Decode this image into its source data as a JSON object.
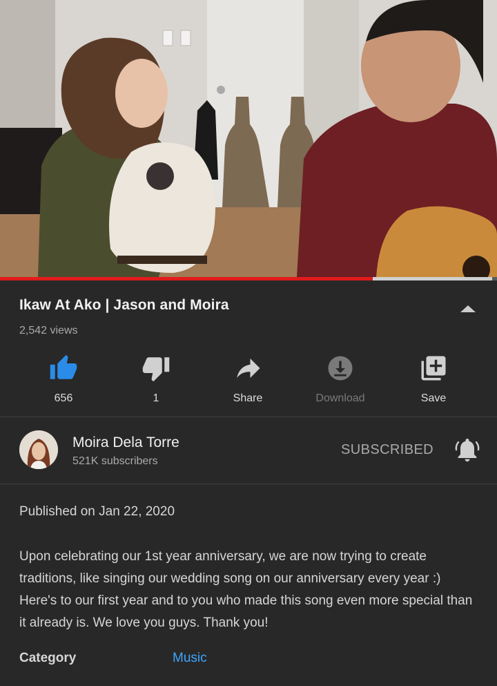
{
  "video": {
    "progress_fraction": 0.75,
    "buffer_fraction": 0.99
  },
  "title": "Ikaw At Ako | Jason and Moira",
  "views": "2,542 views",
  "actions": [
    {
      "icon": "thumbs-up-icon",
      "label": "656",
      "active": true
    },
    {
      "icon": "thumbs-down-icon",
      "label": "1",
      "active": false
    },
    {
      "icon": "share-icon",
      "label": "Share",
      "active": false
    },
    {
      "icon": "download-icon",
      "label": "Download",
      "active": false,
      "disabled": true
    },
    {
      "icon": "add-to-playlist-icon",
      "label": "Save",
      "active": false
    }
  ],
  "channel": {
    "name": "Moira Dela Torre",
    "subscribers": "521K subscribers",
    "subscribe_label": "SUBSCRIBED"
  },
  "description": {
    "published": "Published on Jan 22, 2020",
    "text": "Upon celebrating our 1st year anniversary, we are now trying to create traditions, like singing our wedding song on our anniversary every year :) Here's to our first year and to you who made this song even more special than it already is. We love you guys. Thank you!",
    "category_label": "Category",
    "category_value": "Music"
  },
  "colors": {
    "background": "#282828",
    "accent_blue": "#3ea6ff",
    "progress_red": "#e21b1b",
    "like_blue": "#2a8ce8"
  }
}
